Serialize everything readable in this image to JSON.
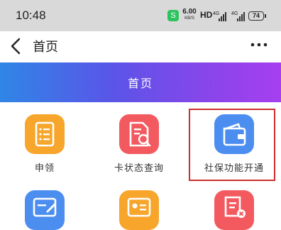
{
  "status_bar": {
    "time": "10:48",
    "app_badge": "S",
    "net_speed_value": "6.00",
    "net_speed_unit": "KB/S",
    "hd_label": "HD",
    "signal_1": "4G",
    "signal_2": "4G",
    "battery": "74"
  },
  "nav": {
    "back_icon": "chevron-left-icon",
    "title": "首页",
    "more_icon": "more-horizontal-icon"
  },
  "banner": {
    "title": "首页",
    "gradient": [
      "#2f86e6",
      "#a63ff0"
    ]
  },
  "grid": {
    "items": [
      {
        "label": "申领",
        "icon": "list-document-icon",
        "color": "#f7a52b"
      },
      {
        "label": "卡状态查询",
        "icon": "document-search-icon",
        "color": "#f35a5f"
      },
      {
        "label": "社保功能开通",
        "icon": "wallet-icon",
        "color": "#4c8ef0"
      },
      {
        "label": "",
        "icon": "card-edit-icon",
        "color": "#4c8ef0"
      },
      {
        "label": "",
        "icon": "id-card-icon",
        "color": "#f7a52b"
      },
      {
        "label": "",
        "icon": "document-close-icon",
        "color": "#f35a5f"
      }
    ]
  },
  "highlight_color": "#cf2d2d"
}
